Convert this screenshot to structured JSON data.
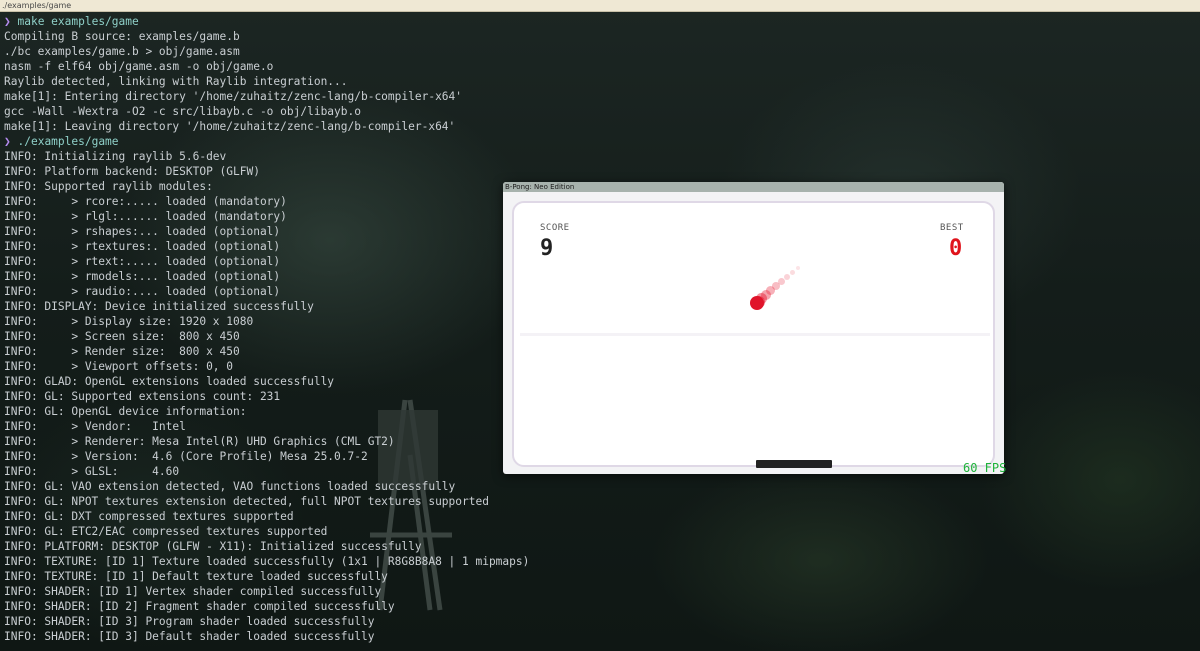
{
  "window": {
    "title": "./examples/game"
  },
  "terminal": {
    "lines": [
      {
        "prompt": "❯",
        "text": "make examples/game"
      },
      {
        "text": "Compiling B source: examples/game.b"
      },
      {
        "text": "./bc examples/game.b > obj/game.asm"
      },
      {
        "text": "nasm -f elf64 obj/game.asm -o obj/game.o"
      },
      {
        "text": "Raylib detected, linking with Raylib integration..."
      },
      {
        "text": "make[1]: Entering directory '/home/zuhaitz/zenc-lang/b-compiler-x64'"
      },
      {
        "text": "gcc -Wall -Wextra -O2 -c src/libayb.c -o obj/libayb.o"
      },
      {
        "text": "make[1]: Leaving directory '/home/zuhaitz/zenc-lang/b-compiler-x64'"
      },
      {
        "prompt": "❯",
        "text": "./examples/game"
      },
      {
        "text": "INFO: Initializing raylib 5.6-dev"
      },
      {
        "text": "INFO: Platform backend: DESKTOP (GLFW)"
      },
      {
        "text": "INFO: Supported raylib modules:"
      },
      {
        "text": "INFO:     > rcore:..... loaded (mandatory)"
      },
      {
        "text": "INFO:     > rlgl:...... loaded (mandatory)"
      },
      {
        "text": "INFO:     > rshapes:... loaded (optional)"
      },
      {
        "text": "INFO:     > rtextures:. loaded (optional)"
      },
      {
        "text": "INFO:     > rtext:..... loaded (optional)"
      },
      {
        "text": "INFO:     > rmodels:... loaded (optional)"
      },
      {
        "text": "INFO:     > raudio:.... loaded (optional)"
      },
      {
        "text": "INFO: DISPLAY: Device initialized successfully"
      },
      {
        "text": "INFO:     > Display size: 1920 x 1080"
      },
      {
        "text": "INFO:     > Screen size:  800 x 450"
      },
      {
        "text": "INFO:     > Render size:  800 x 450"
      },
      {
        "text": "INFO:     > Viewport offsets: 0, 0"
      },
      {
        "text": "INFO: GLAD: OpenGL extensions loaded successfully"
      },
      {
        "text": "INFO: GL: Supported extensions count: 231"
      },
      {
        "text": "INFO: GL: OpenGL device information:"
      },
      {
        "text": "INFO:     > Vendor:   Intel"
      },
      {
        "text": "INFO:     > Renderer: Mesa Intel(R) UHD Graphics (CML GT2)"
      },
      {
        "text": "INFO:     > Version:  4.6 (Core Profile) Mesa 25.0.7-2"
      },
      {
        "text": "INFO:     > GLSL:     4.60"
      },
      {
        "text": "INFO: GL: VAO extension detected, VAO functions loaded successfully"
      },
      {
        "text": "INFO: GL: NPOT textures extension detected, full NPOT textures supported"
      },
      {
        "text": "INFO: GL: DXT compressed textures supported"
      },
      {
        "text": "INFO: GL: ETC2/EAC compressed textures supported"
      },
      {
        "text": "INFO: PLATFORM: DESKTOP (GLFW - X11): Initialized successfully"
      },
      {
        "text": "INFO: TEXTURE: [ID 1] Texture loaded successfully (1x1 | R8G8B8A8 | 1 mipmaps)"
      },
      {
        "text": "INFO: TEXTURE: [ID 1] Default texture loaded successfully"
      },
      {
        "text": "INFO: SHADER: [ID 1] Vertex shader compiled successfully"
      },
      {
        "text": "INFO: SHADER: [ID 2] Fragment shader compiled successfully"
      },
      {
        "text": "INFO: SHADER: [ID 3] Program shader loaded successfully"
      },
      {
        "text": "INFO: SHADER: [ID 3] Default shader loaded successfully"
      }
    ]
  },
  "game": {
    "title": "B-Pong: Neo Edition",
    "score_label": "SCORE",
    "score": "9",
    "best_label": "BEST",
    "best": "0",
    "fps": "60 FPS"
  },
  "colors": {
    "ball": "#e0142a",
    "best": "#e0141c",
    "fps": "#1fb33a",
    "prompt": "#b58cf0",
    "command": "#8fd0c8"
  }
}
